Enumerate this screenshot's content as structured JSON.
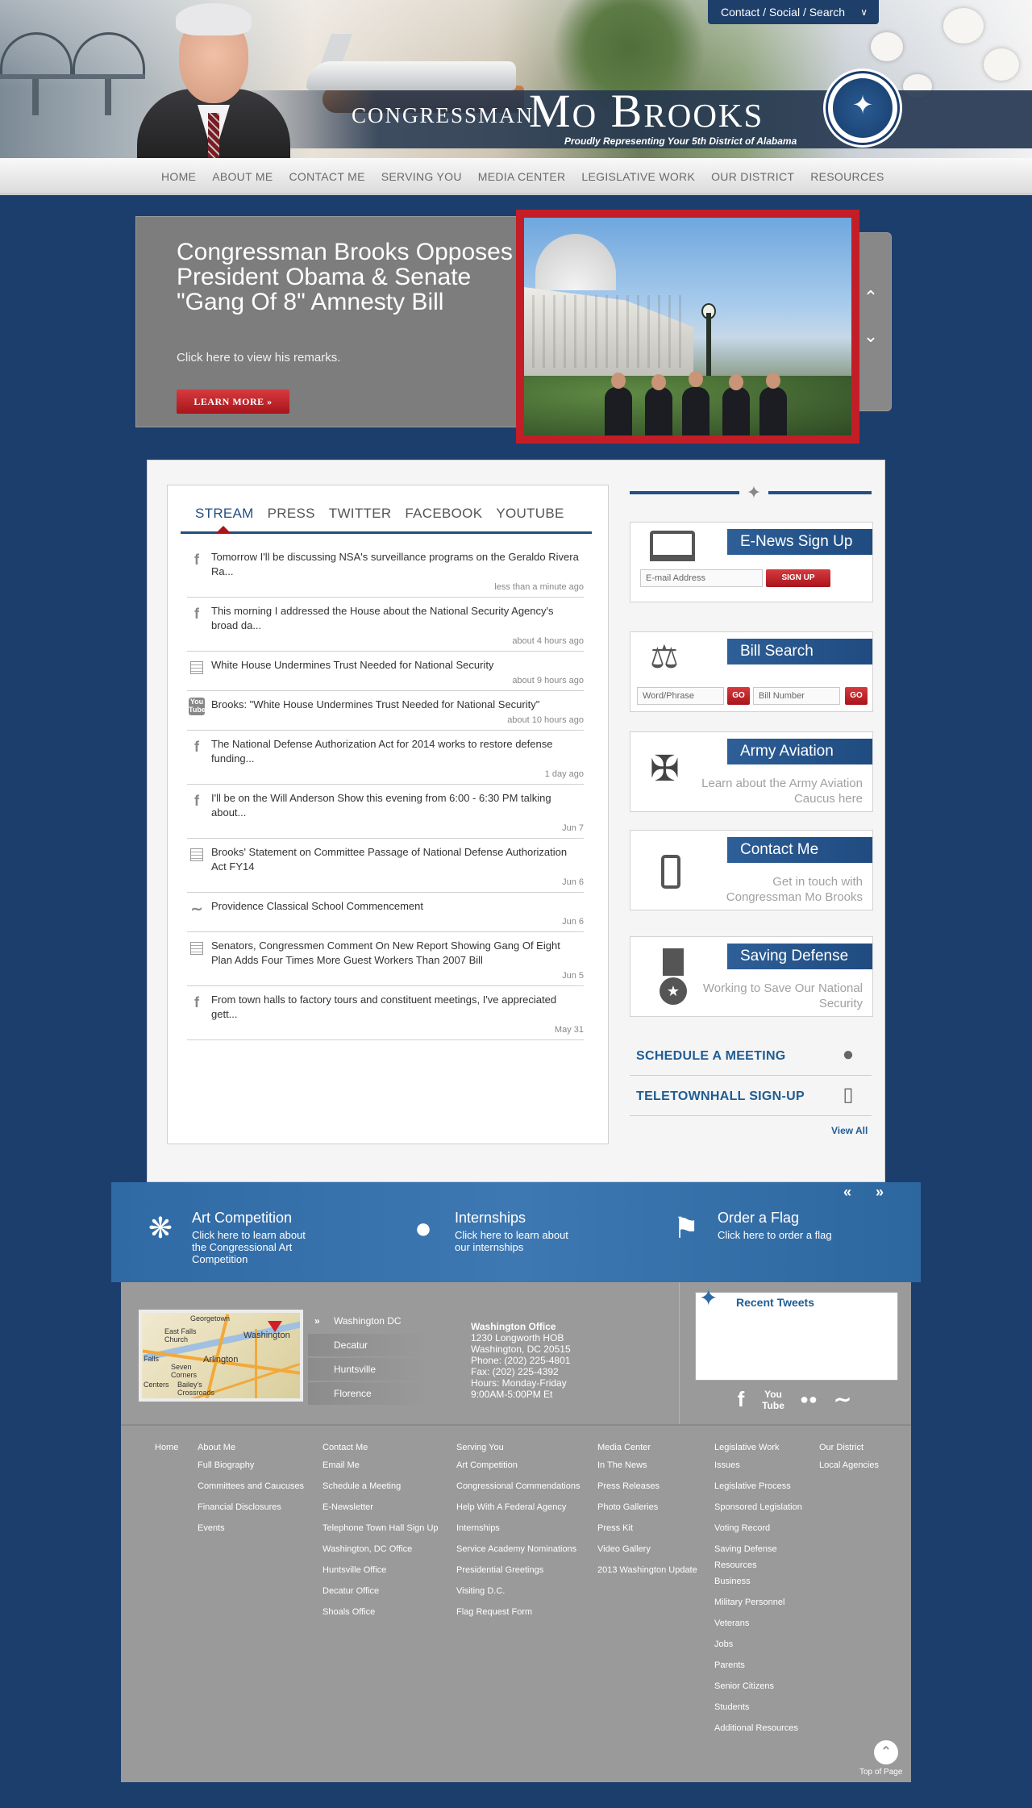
{
  "header": {
    "contact_bar_label": "Contact / Social / Search",
    "congressman": "Congressman",
    "name": "Mo Brooks",
    "tagline": "Proudly Representing Your 5th District of Alabama"
  },
  "nav": {
    "items": [
      "HOME",
      "ABOUT ME",
      "CONTACT ME",
      "SERVING YOU",
      "MEDIA CENTER",
      "LEGISLATIVE WORK",
      "OUR DISTRICT",
      "RESOURCES"
    ]
  },
  "slider": {
    "headline": "Congressman Brooks Opposes President Obama & Senate \"Gang Of 8\" Amnesty Bill",
    "subtext": "Click here to view his remarks.",
    "button_label": "LEARN MORE »"
  },
  "stream": {
    "tabs": [
      "STREAM",
      "PRESS",
      "TWITTER",
      "FACEBOOK",
      "YOUTUBE"
    ],
    "items": [
      {
        "icon": "facebook-icon",
        "text": "Tomorrow I'll be discussing NSA's surveillance programs on the Geraldo Rivera Ra...",
        "time": "less than a minute ago"
      },
      {
        "icon": "facebook-icon",
        "text": "This morning I addressed the House about the National Security Agency's broad da...",
        "time": "about 4 hours ago"
      },
      {
        "icon": "document-icon",
        "text": "White House Undermines Trust Needed for National Security",
        "time": "about 9 hours ago"
      },
      {
        "icon": "youtube-icon",
        "text": "Brooks: \"White House Undermines Trust Needed for National Security\"",
        "time": "about 10 hours ago"
      },
      {
        "icon": "facebook-icon",
        "text": "The National Defense Authorization Act for 2014 works to restore defense funding...",
        "time": "1 day ago"
      },
      {
        "icon": "facebook-icon",
        "text": "I'll be on the Will Anderson Show this evening from 6:00 - 6:30 PM talking about...",
        "time": "Jun 7"
      },
      {
        "icon": "document-icon",
        "text": "Brooks' Statement on Committee Passage of National Defense Authorization Act FY14",
        "time": "Jun 6"
      },
      {
        "icon": "rss-icon",
        "text": "Providence Classical School Commencement",
        "time": "Jun 6"
      },
      {
        "icon": "document-icon",
        "text": "Senators, Congressmen Comment On New Report Showing Gang Of Eight Plan Adds Four Times More Guest Workers Than 2007 Bill",
        "time": "Jun 5"
      },
      {
        "icon": "facebook-icon",
        "text": "From town halls to factory tours and constituent meetings, I've appreciated gett...",
        "time": "May 31"
      }
    ]
  },
  "sidebar": {
    "enews": {
      "title": "E-News Sign Up",
      "email_placeholder": "E-mail Address",
      "button": "SIGN UP"
    },
    "bill_search": {
      "title": "Bill Search",
      "word_placeholder": "Word/Phrase",
      "number_placeholder": "Bill Number",
      "go": "GO"
    },
    "army": {
      "title": "Army Aviation",
      "desc": "Learn about the Army Aviation Caucus here"
    },
    "contact": {
      "title": "Contact Me",
      "desc": "Get in touch with Congressman Mo Brooks"
    },
    "defense": {
      "title": "Saving Defense",
      "desc": "Working to Save Our National Security"
    },
    "links": [
      "SCHEDULE A MEETING",
      "TELETOWNHALL SIGN-UP"
    ],
    "view_all": "View All"
  },
  "promo": {
    "prev": "«",
    "next": "»",
    "items": [
      {
        "title": "Art Competition",
        "desc": "Click here to learn about the Congressional Art Competition"
      },
      {
        "title": "Internships",
        "desc": "Click here to learn about our internships"
      },
      {
        "title": "Order a Flag",
        "desc": "Click here to order a flag"
      }
    ]
  },
  "footer": {
    "map_labels": [
      "Georgetown",
      "East Falls Church",
      "Arlington",
      "Washington",
      "Seven Corners",
      "Falls",
      "Bailey's Crossroads",
      "Centers"
    ],
    "locations": [
      "Washington DC",
      "Decatur",
      "Huntsville",
      "Florence"
    ],
    "office": {
      "title": "Washington Office",
      "lines": [
        "1230 Longworth HOB",
        "Washington, DC 20515",
        "Phone: (202) 225-4801",
        "Fax: (202) 225-4392",
        "Hours: Monday-Friday",
        "9:00AM-5:00PM Et"
      ]
    },
    "tweets_title": "Recent Tweets",
    "columns": [
      {
        "head": "Home",
        "links": []
      },
      {
        "head": "About Me",
        "links": [
          "Full Biography",
          "Committees and Caucuses",
          "Financial Disclosures",
          "Events"
        ]
      },
      {
        "head": "Contact Me",
        "links": [
          "Email Me",
          "Schedule a Meeting",
          "E-Newsletter",
          "Telephone Town Hall Sign Up",
          "Washington, DC Office",
          "Huntsville Office",
          "Decatur Office",
          "Shoals Office"
        ]
      },
      {
        "head": "Serving You",
        "links": [
          "Art Competition",
          "Congressional Commendations",
          "Help With A Federal Agency",
          "Internships",
          "Service Academy Nominations",
          "Presidential Greetings",
          "Visiting D.C.",
          "Flag Request Form"
        ]
      },
      {
        "head": "Media Center",
        "links": [
          "In The News",
          "Press Releases",
          "Photo Galleries",
          "Press Kit",
          "Video Gallery",
          "2013 Washington Update"
        ]
      },
      {
        "head": "Legislative Work",
        "links": [
          "Issues",
          "Legislative Process",
          "Sponsored Legislation",
          "Voting Record",
          "Saving Defense",
          "Resources",
          "Business",
          "Military Personnel",
          "Veterans",
          "Jobs",
          "Parents",
          "Senior Citizens",
          "Students",
          "Additional Resources"
        ]
      },
      {
        "head": "Our District",
        "links": [
          "Local Agencies"
        ]
      }
    ],
    "top_label": "Top of Page"
  },
  "colors": {
    "navy": "#1c3e6c",
    "accent_red": "#c31e27",
    "link_blue": "#1f5d94"
  }
}
